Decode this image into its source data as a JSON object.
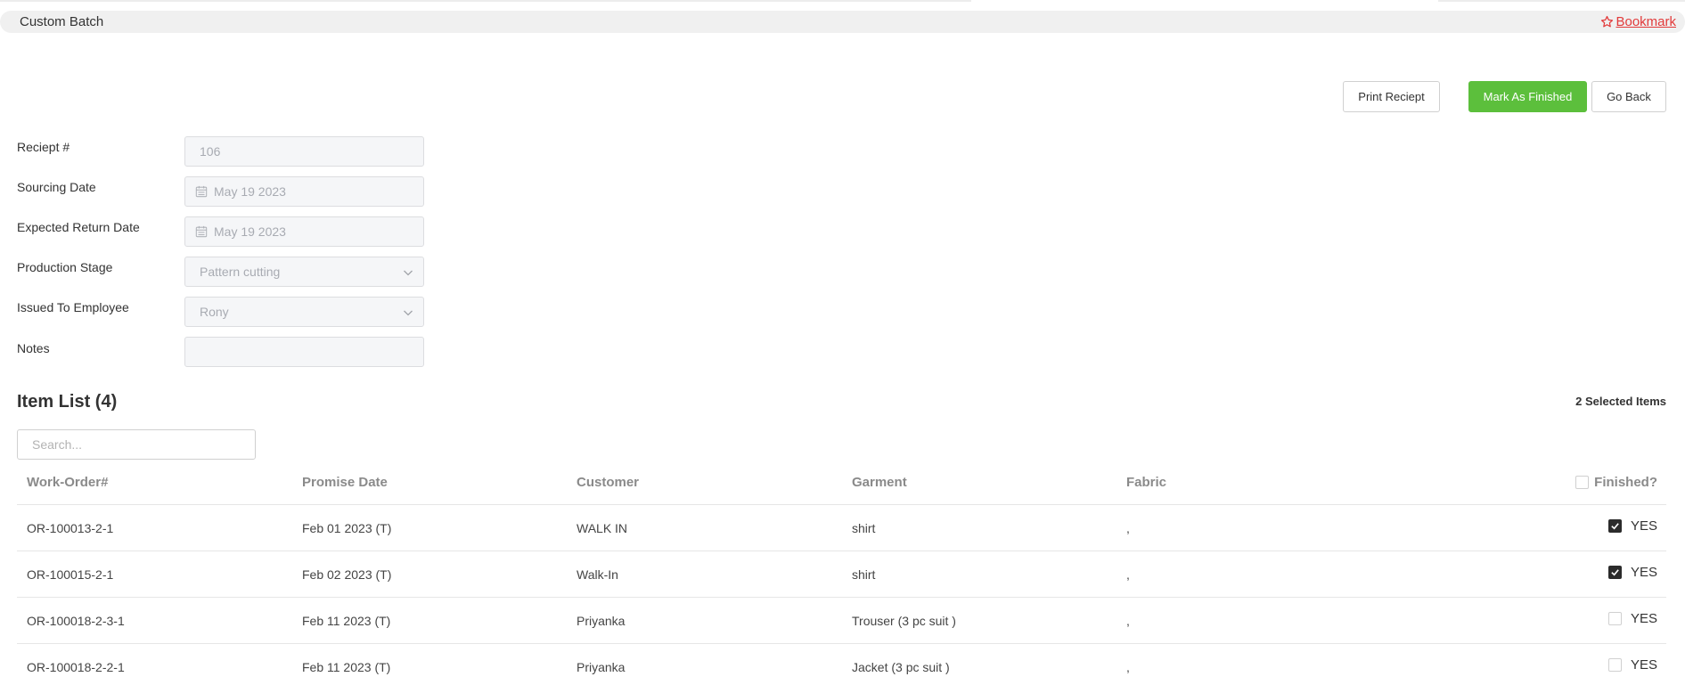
{
  "header": {
    "title": "Custom Batch",
    "bookmark_label": " Bookmark"
  },
  "actions": {
    "print": "Print Reciept",
    "finish": "Mark As Finished",
    "back": "Go Back"
  },
  "form": {
    "receipt_label": "Reciept #",
    "receipt_value": "106",
    "sourcing_label": "Sourcing Date",
    "sourcing_value": "May 19 2023",
    "return_label": "Expected Return Date",
    "return_value": "May 19 2023",
    "stage_label": "Production Stage",
    "stage_value": "Pattern cutting",
    "employee_label": "Issued To Employee",
    "employee_value": "Rony",
    "notes_label": "Notes",
    "notes_value": ""
  },
  "items": {
    "title": "Item List (4)",
    "selected": "2 Selected Items",
    "search_placeholder": "Search...",
    "columns": [
      "Work-Order#",
      "Promise Date",
      "Customer",
      "Garment",
      "Fabric",
      "Finished?"
    ],
    "rows": [
      {
        "work_order": "OR-100013-2-1",
        "promise_date": "Feb 01 2023 (T)",
        "customer": "WALK IN",
        "garment": "shirt",
        "fabric": ",",
        "finished": true,
        "finished_label": "YES"
      },
      {
        "work_order": "OR-100015-2-1",
        "promise_date": "Feb 02 2023 (T)",
        "customer": "Walk-In",
        "garment": "shirt",
        "fabric": ",",
        "finished": true,
        "finished_label": "YES"
      },
      {
        "work_order": "OR-100018-2-3-1",
        "promise_date": "Feb 11 2023 (T)",
        "customer": "Priyanka",
        "garment": "Trouser (3 pc suit )",
        "fabric": ",",
        "finished": false,
        "finished_label": "YES"
      },
      {
        "work_order": "OR-100018-2-2-1",
        "promise_date": "Feb 11 2023 (T)",
        "customer": "Priyanka",
        "garment": "Jacket (3 pc suit )",
        "fabric": ",",
        "finished": false,
        "finished_label": "YES"
      }
    ]
  },
  "colors": {
    "accent_green": "#5cbf3c",
    "bookmark_red": "#e23a3a",
    "checkbox_dark": "#2b2b2b"
  },
  "icons": {
    "bookmark": "star-outline-icon",
    "date": "calendar-icon",
    "select": "chevron-down-icon",
    "check": "checkmark-icon"
  }
}
